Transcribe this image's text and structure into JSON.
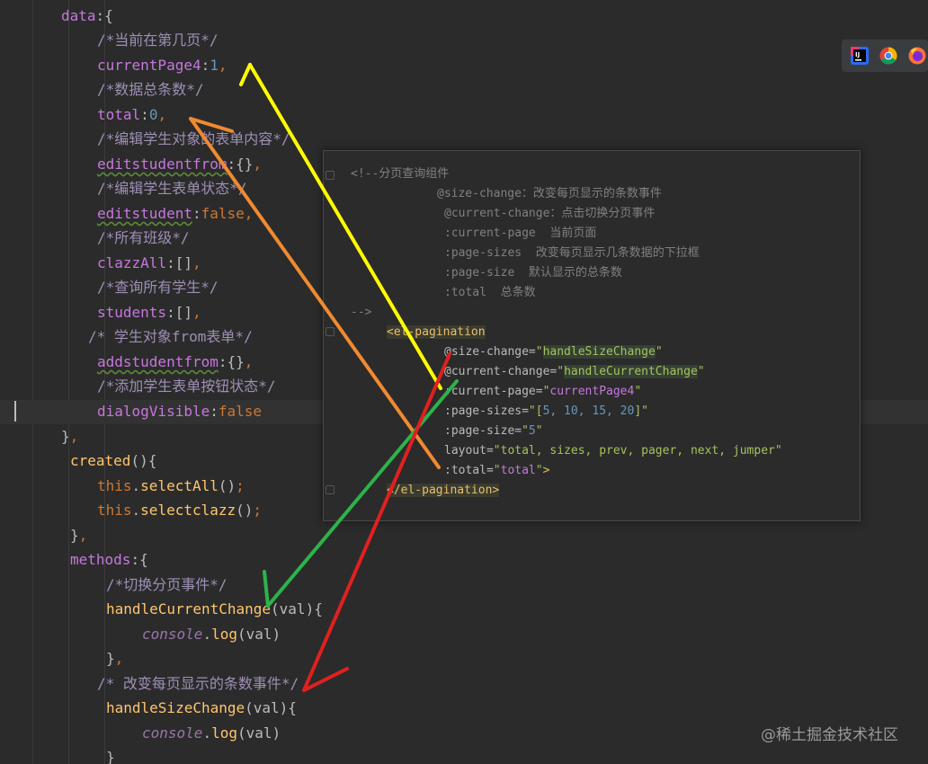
{
  "editor": {
    "lines": [
      [
        {
          "t": "data",
          "c": "key"
        },
        {
          "t": ":{",
          "c": "plain"
        }
      ],
      [
        {
          "t": "/*当前在第几页*/",
          "c": "comment"
        }
      ],
      [
        {
          "t": "currentPage4",
          "c": "key"
        },
        {
          "t": ":",
          "c": "plain"
        },
        {
          "t": "1",
          "c": "num"
        },
        {
          "t": ",",
          "c": "kw"
        }
      ],
      [
        {
          "t": "/*数据总条数*/",
          "c": "comment"
        }
      ],
      [
        {
          "t": "total",
          "c": "key"
        },
        {
          "t": ":",
          "c": "plain"
        },
        {
          "t": "0",
          "c": "num"
        },
        {
          "t": ",",
          "c": "kw"
        }
      ],
      [
        {
          "t": "/*编辑学生对象的表单内容*/",
          "c": "comment"
        }
      ],
      [
        {
          "t": "editstudentfrom",
          "c": "key wavy"
        },
        {
          "t": ":{}",
          "c": "plain"
        },
        {
          "t": ",",
          "c": "kw"
        }
      ],
      [
        {
          "t": "/*编辑学生表单状态*/",
          "c": "comment"
        }
      ],
      [
        {
          "t": "editstudent",
          "c": "key wavy"
        },
        {
          "t": ":",
          "c": "plain"
        },
        {
          "t": "false",
          "c": "kw"
        },
        {
          "t": ",",
          "c": "kw"
        }
      ],
      [
        {
          "t": "/*所有班级*/",
          "c": "comment"
        }
      ],
      [
        {
          "t": "clazzAll",
          "c": "key"
        },
        {
          "t": ":[]",
          "c": "plain"
        },
        {
          "t": ",",
          "c": "kw"
        }
      ],
      [
        {
          "t": "/*查询所有学生*/",
          "c": "comment"
        }
      ],
      [
        {
          "t": "students",
          "c": "key"
        },
        {
          "t": ":[]",
          "c": "plain"
        },
        {
          "t": ",",
          "c": "kw"
        }
      ],
      [
        {
          "t": "/* 学生对象from表单*/",
          "c": "comment"
        }
      ],
      [
        {
          "t": "addstudentfrom",
          "c": "key wavy"
        },
        {
          "t": ":{}",
          "c": "plain"
        },
        {
          "t": ",",
          "c": "kw"
        }
      ],
      [
        {
          "t": "/*添加学生表单按钮状态*/",
          "c": "comment"
        }
      ],
      [
        {
          "t": "dialogVisible",
          "c": "key"
        },
        {
          "t": ":",
          "c": "plain"
        },
        {
          "t": "false",
          "c": "kw"
        }
      ],
      [
        {
          "t": "}",
          "c": "plain"
        },
        {
          "t": ",",
          "c": "kw"
        }
      ],
      [
        {
          "t": "created",
          "c": "fn"
        },
        {
          "t": "(){",
          "c": "plain"
        }
      ],
      [
        {
          "t": "this",
          "c": "kw"
        },
        {
          "t": ".",
          "c": "plain"
        },
        {
          "t": "selectAll",
          "c": "fn"
        },
        {
          "t": "()",
          "c": "plain"
        },
        {
          "t": ";",
          "c": "kw"
        }
      ],
      [
        {
          "t": "this",
          "c": "kw"
        },
        {
          "t": ".",
          "c": "plain"
        },
        {
          "t": "selectclazz",
          "c": "fn"
        },
        {
          "t": "()",
          "c": "plain"
        },
        {
          "t": ";",
          "c": "kw"
        }
      ],
      [
        {
          "t": "}",
          "c": "plain"
        },
        {
          "t": ",",
          "c": "kw"
        }
      ],
      [
        {
          "t": "methods",
          "c": "key"
        },
        {
          "t": ":{",
          "c": "plain"
        }
      ],
      [
        {
          "t": "/*切换分页事件*/",
          "c": "comment"
        }
      ],
      [
        {
          "t": "handleCurrentChange",
          "c": "fn"
        },
        {
          "t": "(val){",
          "c": "plain"
        }
      ],
      [
        {
          "t": "console",
          "c": "ital"
        },
        {
          "t": ".",
          "c": "plain"
        },
        {
          "t": "log",
          "c": "fn"
        },
        {
          "t": "(val)",
          "c": "plain"
        }
      ],
      [
        {
          "t": "}",
          "c": "plain"
        },
        {
          "t": ",",
          "c": "kw"
        }
      ],
      [
        {
          "t": "/* 改变每页显示的条数事件*/",
          "c": "comment"
        }
      ],
      [
        {
          "t": "handleSizeChange",
          "c": "fn"
        },
        {
          "t": "(val){",
          "c": "plain"
        }
      ],
      [
        {
          "t": "console",
          "c": "ital"
        },
        {
          "t": ".",
          "c": "plain"
        },
        {
          "t": "log",
          "c": "fn"
        },
        {
          "t": "(val)",
          "c": "plain"
        }
      ],
      [
        {
          "t": "}",
          "c": "plain"
        }
      ]
    ]
  },
  "panel": {
    "lines": [
      [
        {
          "t": "<!--分页查询组件",
          "c": "comment"
        }
      ],
      [
        {
          "t": "@size-change：改变每页显示的条数事件",
          "c": "comment"
        }
      ],
      [
        {
          "t": "@current-change：点击切换分页事件",
          "c": "comment"
        }
      ],
      [
        {
          "t": ":current-page  当前页面",
          "c": "comment"
        }
      ],
      [
        {
          "t": ":page-sizes  改变每页显示几条数据的下拉框",
          "c": "comment"
        }
      ],
      [
        {
          "t": ":page-size  默认显示的总条数",
          "c": "comment"
        }
      ],
      [
        {
          "t": ":total  总条数",
          "c": "comment"
        }
      ],
      [
        {
          "t": "-->",
          "c": "comment"
        }
      ],
      [
        {
          "t": "<el-pagination",
          "c": "tag tagbg"
        }
      ],
      [
        {
          "t": "@size-change=",
          "c": "attr"
        },
        {
          "t": "\"",
          "c": "str"
        },
        {
          "t": "handleSizeChange",
          "c": "str strbg"
        },
        {
          "t": "\"",
          "c": "str"
        }
      ],
      [
        {
          "t": "@current-change=",
          "c": "attr"
        },
        {
          "t": "\"",
          "c": "str"
        },
        {
          "t": "handleCurrentChange",
          "c": "str strbg"
        },
        {
          "t": "\"",
          "c": "str"
        }
      ],
      [
        {
          "t": ":current-page=",
          "c": "attr"
        },
        {
          "t": "\"",
          "c": "str"
        },
        {
          "t": "currentPage4",
          "c": "key"
        },
        {
          "t": "\"",
          "c": "str"
        }
      ],
      [
        {
          "t": ":page-sizes=",
          "c": "attr"
        },
        {
          "t": "\"[",
          "c": "str"
        },
        {
          "t": "5, 10, 15, 20",
          "c": "num"
        },
        {
          "t": "]\"",
          "c": "str"
        }
      ],
      [
        {
          "t": ":page-size=",
          "c": "attr"
        },
        {
          "t": "\"",
          "c": "str"
        },
        {
          "t": "5",
          "c": "num"
        },
        {
          "t": "\"",
          "c": "str"
        }
      ],
      [
        {
          "t": "layout=",
          "c": "attr"
        },
        {
          "t": "\"total, sizes, prev, pager, next, jumper\"",
          "c": "str"
        }
      ],
      [
        {
          "t": ":total=",
          "c": "attr"
        },
        {
          "t": "\"",
          "c": "str"
        },
        {
          "t": "total",
          "c": "key"
        },
        {
          "t": "\"",
          "c": "str"
        },
        {
          "t": ">",
          "c": "tag"
        }
      ],
      [
        {
          "t": "</el-pagination>",
          "c": "tag tagbg"
        }
      ]
    ]
  },
  "ide_icons": [
    "jetbrains-icon",
    "chrome-icon",
    "firefox-icon"
  ],
  "annotation_colors": {
    "yellow": "#ffff00",
    "orange": "#f08a30",
    "green": "#2db34a",
    "red": "#e02020"
  },
  "watermark": "@稀土掘金技术社区"
}
